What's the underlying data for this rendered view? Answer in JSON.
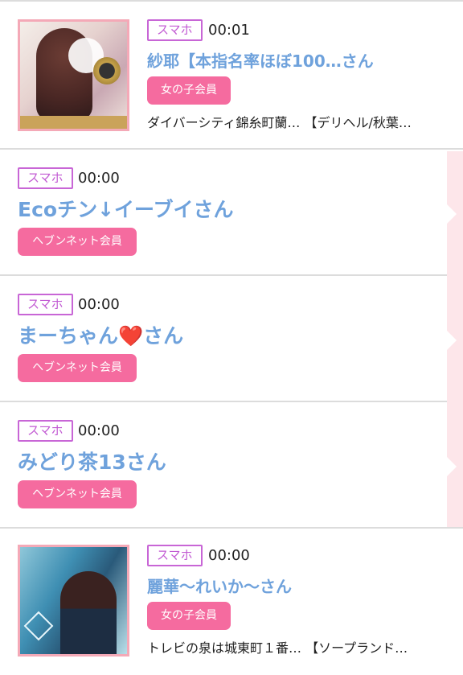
{
  "entries": [
    {
      "badge": "スマホ",
      "time": "00:01",
      "name": "紗耶【本指名率ほぼ100…さん",
      "membership": "女の子会員",
      "shop": "ダイバーシティ錦糸町蘭… 【デリヘル/秋葉…",
      "thumbnail": "girl-photo"
    },
    {
      "badge": "スマホ",
      "time": "00:00",
      "name": "Ecoチン↓イーブイさん",
      "membership": "ヘブンネット会員"
    },
    {
      "badge": "スマホ",
      "time": "00:00",
      "name": "まーちゃん",
      "name_suffix": "さん",
      "heart": "❤️",
      "membership": "ヘブンネット会員"
    },
    {
      "badge": "スマホ",
      "time": "00:00",
      "name": "みどり茶13さん",
      "membership": "ヘブンネット会員"
    },
    {
      "badge": "スマホ",
      "time": "00:00",
      "name": "麗華〜れいか〜さん",
      "membership": "女の子会員",
      "shop": "トレビの泉は城東町１番… 【ソープランド…",
      "thumbnail": "girl-photo"
    }
  ],
  "colors": {
    "badge_border": "#c866d6",
    "name": "#6fa2dc",
    "pill": "#f56b9f",
    "side_bar": "#fde6ea"
  }
}
